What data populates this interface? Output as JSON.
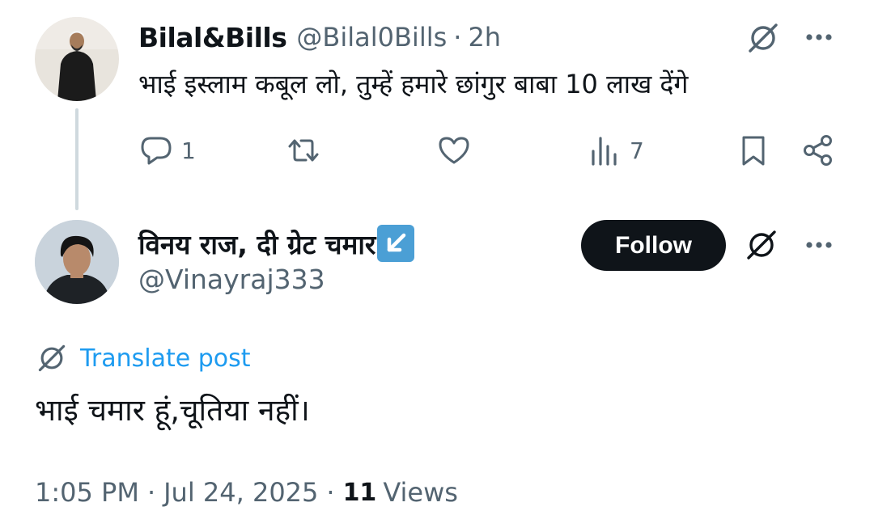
{
  "reply": {
    "name": "Bilal&Bills",
    "handle": "@Bilal0Bills",
    "dot": "·",
    "time": "2h",
    "text": "भाई इस्लाम कबूल लो, तुम्हें हमारे छांगुर बाबा 10 लाख देंगे",
    "actions": {
      "reply_count": "1",
      "retweet_count": "",
      "like_count": "",
      "views_count": "7"
    }
  },
  "main": {
    "name": "विनय राज, दी ग्रेट चमार",
    "handle": "@Vinayraj333",
    "follow_label": "Follow",
    "translate_label": "Translate post",
    "text": "भाई चमार हूं,चूतिया नहीं।",
    "meta": {
      "time": "1:05 PM",
      "dot1": "·",
      "date": "Jul 24, 2025",
      "dot2": "·",
      "views_count": "11",
      "views_label": "Views"
    }
  },
  "icons": {
    "grok": "grok-icon",
    "more": "more-icon",
    "reply": "reply-icon",
    "retweet": "retweet-icon",
    "like": "heart-icon",
    "views": "views-icon",
    "bookmark": "bookmark-icon",
    "share": "share-icon",
    "badge": "arrow-down-left-icon"
  },
  "colors": {
    "text": "#0f1419",
    "secondary": "#536471",
    "link": "#1d9bf0",
    "follow_bg": "#0f1419",
    "badge_bg": "#4b9fd5",
    "thread_line": "#cfd9de"
  }
}
